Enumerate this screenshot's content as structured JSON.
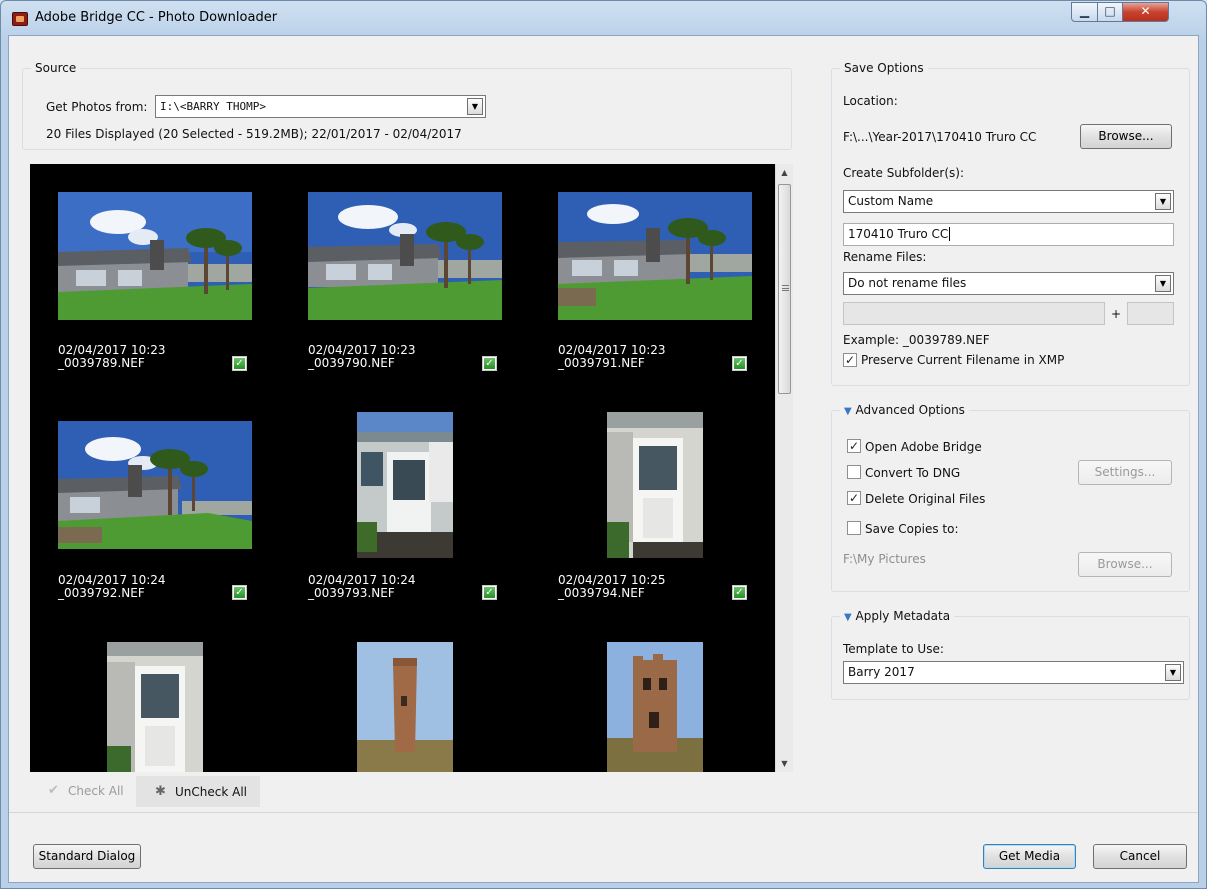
{
  "window": {
    "title": "Adobe Bridge CC - Photo Downloader"
  },
  "source": {
    "group_label": "Source",
    "get_photos_label": "Get Photos from:",
    "get_photos_value": "I:\\<BARRY THOMP>",
    "files_info": "20 Files Displayed (20 Selected - 519.2MB); 22/01/2017 - 02/04/2017"
  },
  "thumbnails": [
    {
      "datetime": "02/04/2017 10:23",
      "filename": "_0039789.NEF",
      "checked": true
    },
    {
      "datetime": "02/04/2017 10:23",
      "filename": "_0039790.NEF",
      "checked": true
    },
    {
      "datetime": "02/04/2017 10:23",
      "filename": "_0039791.NEF",
      "checked": true
    },
    {
      "datetime": "02/04/2017 10:24",
      "filename": "_0039792.NEF",
      "checked": true
    },
    {
      "datetime": "02/04/2017 10:24",
      "filename": "_0039793.NEF",
      "checked": true
    },
    {
      "datetime": "02/04/2017 10:25",
      "filename": "_0039794.NEF",
      "checked": true
    }
  ],
  "grid_toolbar": {
    "check_all": "Check All",
    "uncheck_all": "UnCheck All"
  },
  "save_options": {
    "group_label": "Save Options",
    "location_label": "Location:",
    "location_value": "F:\\...\\Year-2017\\170410 Truro CC",
    "browse": "Browse...",
    "create_subfolders_label": "Create Subfolder(s):",
    "create_subfolders_value": "Custom Name",
    "custom_name_value": "170410 Truro CC",
    "rename_files_label": "Rename Files:",
    "rename_files_value": "Do not rename files",
    "plus": "+",
    "example": "Example:  _0039789.NEF",
    "preserve_filename": "Preserve Current Filename in XMP"
  },
  "advanced": {
    "group_label": "Advanced Options",
    "open_bridge": "Open Adobe Bridge",
    "convert_dng": "Convert To DNG",
    "settings": "Settings...",
    "delete_originals": "Delete Original Files",
    "save_copies": "Save Copies to:",
    "copies_path": "F:\\My Pictures",
    "browse": "Browse..."
  },
  "metadata": {
    "group_label": "Apply Metadata",
    "template_label": "Template to Use:",
    "template_value": "Barry 2017"
  },
  "footer": {
    "standard_dialog": "Standard Dialog",
    "get_media": "Get Media",
    "cancel": "Cancel"
  },
  "colors": {
    "accent": "#3a76c4",
    "check_green": "#279127",
    "viewer_bg": "#000000"
  }
}
